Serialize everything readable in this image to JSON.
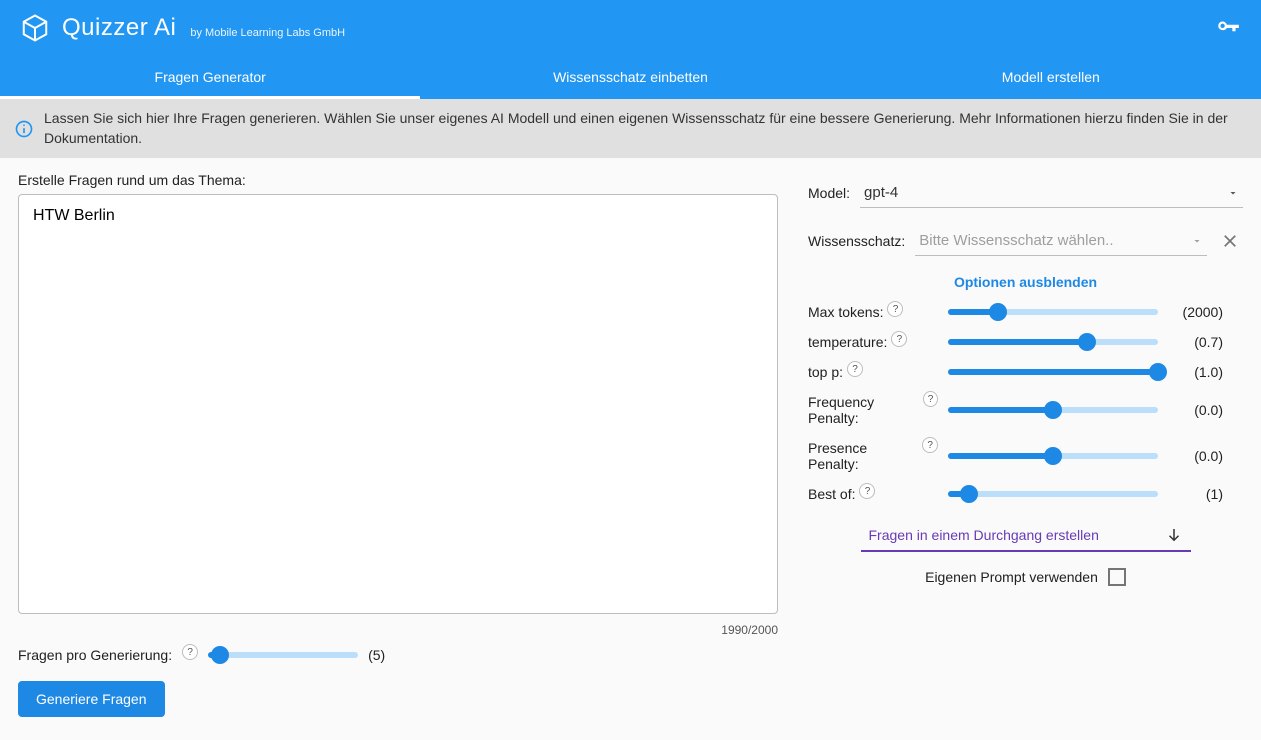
{
  "header": {
    "title": "Quizzer Ai",
    "subtitle": "by Mobile Learning Labs GmbH"
  },
  "tabs": [
    "Fragen Generator",
    "Wissensschatz einbetten",
    "Modell erstellen"
  ],
  "info_text": "Lassen Sie sich hier Ihre Fragen generieren. Wählen Sie unser eigenes AI Modell und einen eigenen Wissensschatz für eine bessere Generierung. Mehr Informationen hierzu finden Sie in der Dokumentation.",
  "left": {
    "topic_label": "Erstelle Fragen rund um das Thema:",
    "topic_value": "HTW Berlin",
    "char_count": "1990/2000",
    "qpg_label": "Fragen pro Generierung:",
    "qpg_value": "(5)",
    "qpg_fill_pct": 8,
    "generate_btn": "Generiere Fragen"
  },
  "right": {
    "model_label": "Model:",
    "model_value": "gpt-4",
    "ws_label": "Wissensschatz:",
    "ws_placeholder": "Bitte Wissensschatz wählen..",
    "opt_toggle": "Optionen ausblenden",
    "params": [
      {
        "label": "Max tokens:",
        "value": "(2000)",
        "fill_pct": 24
      },
      {
        "label": "temperature:",
        "value": "(0.7)",
        "fill_pct": 66
      },
      {
        "label": "top p:",
        "value": "(1.0)",
        "fill_pct": 100
      },
      {
        "label": "Frequency Penalty:",
        "value": "(0.0)",
        "fill_pct": 50
      },
      {
        "label": "Presence Penalty:",
        "value": "(0.0)",
        "fill_pct": 50
      },
      {
        "label": "Best of:",
        "value": "(1)",
        "fill_pct": 10
      }
    ],
    "mode_select": "Fragen in einem Durchgang erstellen",
    "own_prompt_label": "Eigenen Prompt verwenden"
  }
}
